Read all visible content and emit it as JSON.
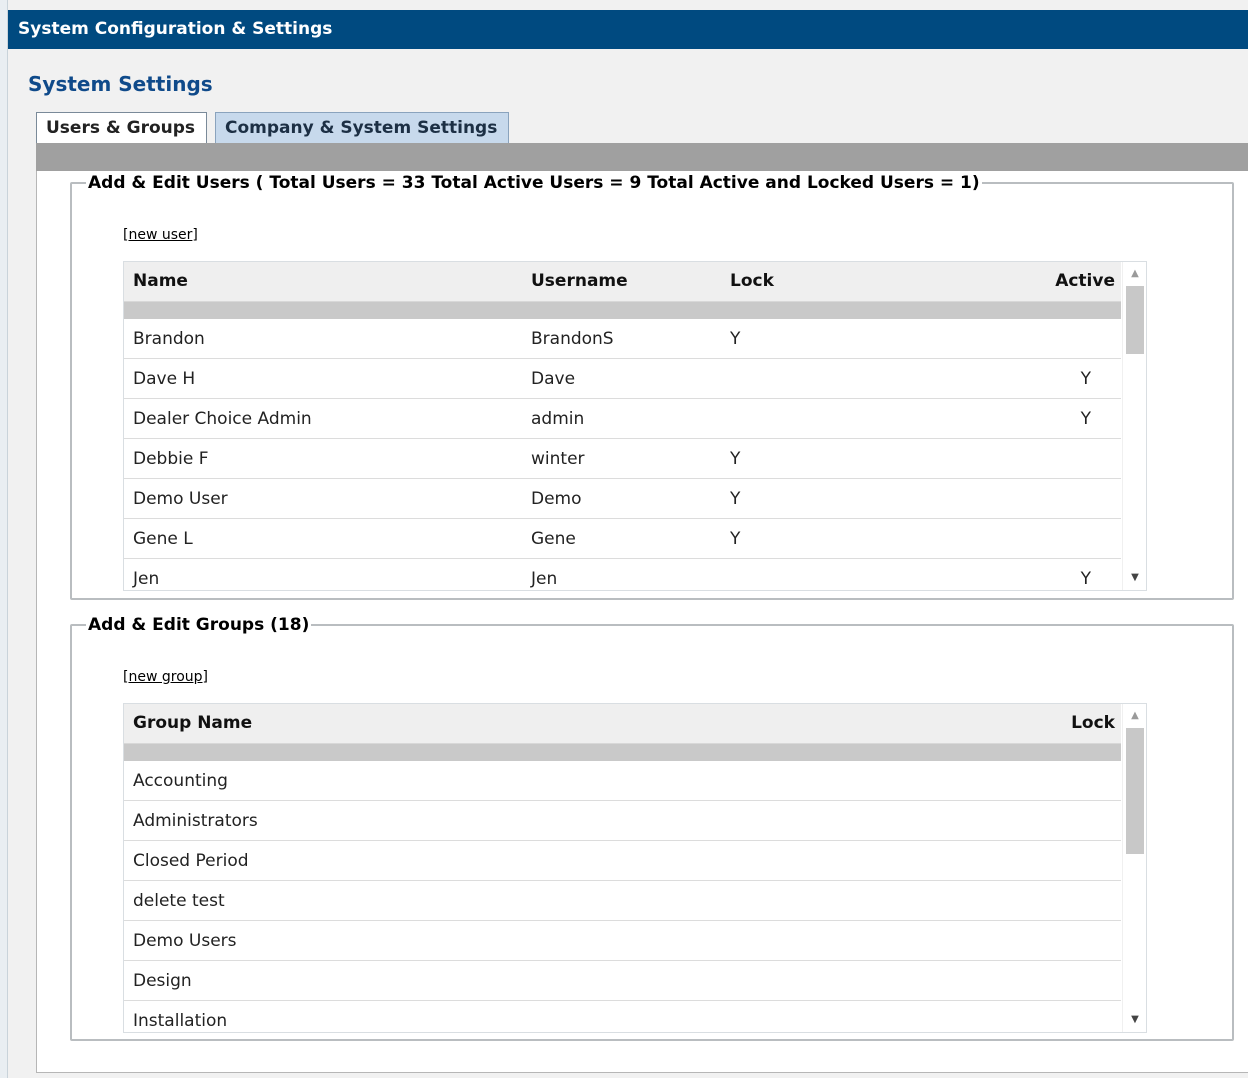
{
  "window": {
    "title": "System Configuration & Settings"
  },
  "page": {
    "section_title": "System Settings"
  },
  "tabs": [
    {
      "label": "Users & Groups",
      "active": true
    },
    {
      "label": "Company & System Settings",
      "active": false
    }
  ],
  "users": {
    "legend": "Add & Edit Users ( Total Users = 33 Total Active Users = 9 Total Active and Locked Users = 1)",
    "new_link_label": "new user",
    "columns": {
      "name": "Name",
      "username": "Username",
      "lock": "Lock",
      "active": "Active"
    },
    "rows": [
      {
        "name": "Brandon",
        "username": "BrandonS",
        "lock": "Y",
        "active": ""
      },
      {
        "name": "Dave H",
        "username": "Dave",
        "lock": "",
        "active": "Y"
      },
      {
        "name": "Dealer Choice Admin",
        "username": "admin",
        "lock": "",
        "active": "Y"
      },
      {
        "name": "Debbie F",
        "username": "winter",
        "lock": "Y",
        "active": ""
      },
      {
        "name": "Demo User",
        "username": "Demo",
        "lock": "Y",
        "active": ""
      },
      {
        "name": "Gene L",
        "username": "Gene",
        "lock": "Y",
        "active": ""
      },
      {
        "name": "Jen",
        "username": "Jen",
        "lock": "",
        "active": "Y"
      }
    ]
  },
  "groups": {
    "legend": "Add & Edit Groups (18)",
    "new_link_label": "new group",
    "columns": {
      "group_name": "Group Name",
      "lock": "Lock"
    },
    "rows": [
      {
        "group_name": "Accounting",
        "lock": ""
      },
      {
        "group_name": "Administrators",
        "lock": ""
      },
      {
        "group_name": "Closed Period",
        "lock": ""
      },
      {
        "group_name": "delete test",
        "lock": ""
      },
      {
        "group_name": "Demo Users",
        "lock": ""
      },
      {
        "group_name": "Design",
        "lock": ""
      },
      {
        "group_name": "Installation",
        "lock": ""
      }
    ]
  },
  "icons": {
    "scroll_up": "scroll-up-arrow-icon",
    "scroll_down": "scroll-down-arrow-icon"
  }
}
